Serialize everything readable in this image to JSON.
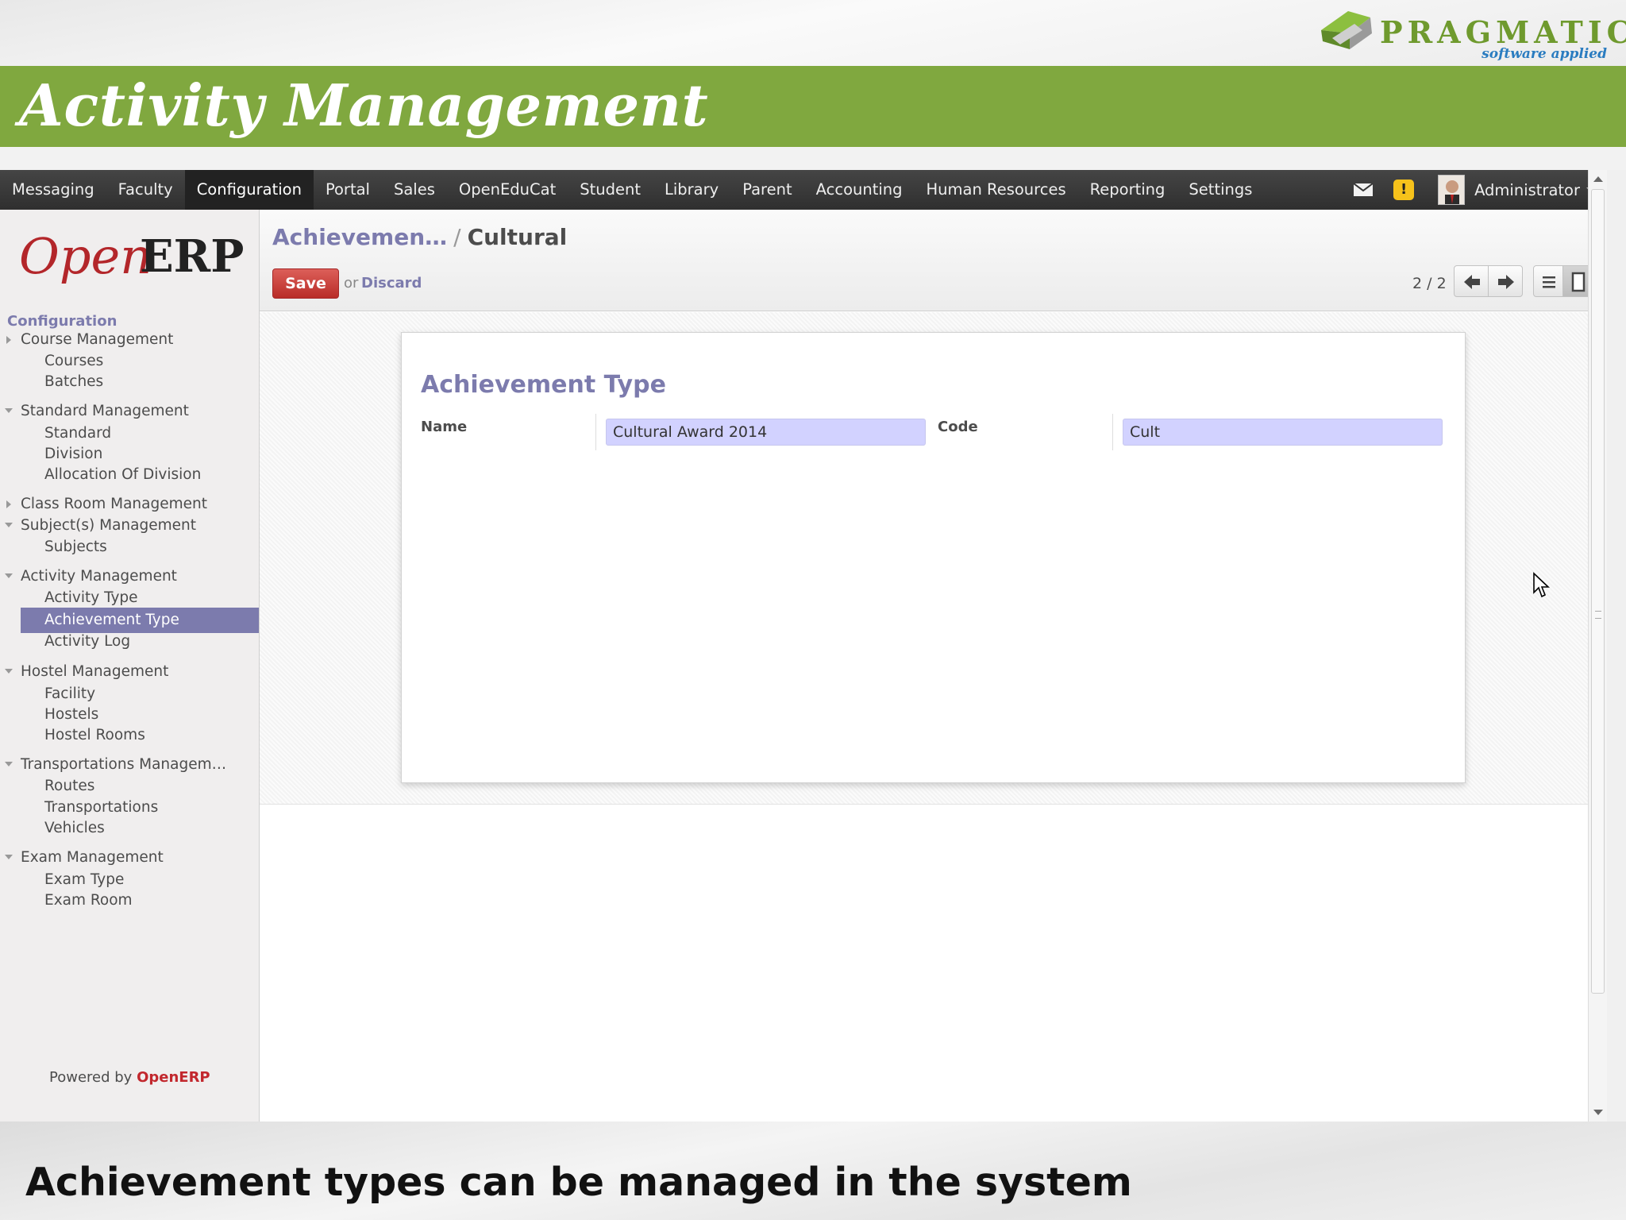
{
  "slide": {
    "brand_name": "PRAGMATIC",
    "brand_tagline": "software applied",
    "title": "Activity Management",
    "caption": "Achievement types can be managed  in the system"
  },
  "topbar": {
    "menu": [
      "Messaging",
      "Faculty",
      "Configuration",
      "Portal",
      "Sales",
      "OpenEduCat",
      "Student",
      "Library",
      "Parent",
      "Accounting",
      "Human Resources",
      "Reporting",
      "Settings"
    ],
    "active_menu": "Configuration",
    "user": "Administrator",
    "alert_glyph": "!"
  },
  "sidebar": {
    "logo_open": "Open",
    "logo_erp": "ERP",
    "section": "Configuration",
    "items": [
      {
        "label": "Course Management",
        "level": 0,
        "state": "closed"
      },
      {
        "label": "Courses",
        "level": 1
      },
      {
        "label": "Batches",
        "level": 1
      },
      {
        "label": "Standard Management",
        "level": 0,
        "state": "open"
      },
      {
        "label": "Standard",
        "level": 1
      },
      {
        "label": "Division",
        "level": 1
      },
      {
        "label": "Allocation Of Division",
        "level": 1
      },
      {
        "label": "Class Room Management",
        "level": 0,
        "state": "closed"
      },
      {
        "label": "Subject(s) Management",
        "level": 0,
        "state": "open"
      },
      {
        "label": "Subjects",
        "level": 1
      },
      {
        "label": "Activity Management",
        "level": 0,
        "state": "open"
      },
      {
        "label": "Activity Type",
        "level": 1
      },
      {
        "label": "Achievement Type",
        "level": 1,
        "selected": true
      },
      {
        "label": "Activity Log",
        "level": 1
      },
      {
        "label": "Hostel Management",
        "level": 0,
        "state": "open"
      },
      {
        "label": "Facility",
        "level": 1
      },
      {
        "label": "Hostels",
        "level": 1
      },
      {
        "label": "Hostel Rooms",
        "level": 1
      },
      {
        "label": "Transportations Managem…",
        "level": 0,
        "state": "open"
      },
      {
        "label": "Routes",
        "level": 1
      },
      {
        "label": "Transportations",
        "level": 1
      },
      {
        "label": "Vehicles",
        "level": 1
      },
      {
        "label": "Exam Management",
        "level": 0,
        "state": "open"
      },
      {
        "label": "Exam Type",
        "level": 1
      },
      {
        "label": "Exam Room",
        "level": 1
      }
    ],
    "powered_prefix": "Powered by ",
    "powered_brand": "OpenERP"
  },
  "content": {
    "breadcrumb_parent": "Achievemen…",
    "breadcrumb_sep": "/",
    "breadcrumb_current": "Cultural",
    "save_label": "Save",
    "or_label": "or",
    "discard_label": "Discard",
    "pager": "2 / 2"
  },
  "form": {
    "title": "Achievement Type",
    "name_label": "Name",
    "name_value": "Cultural Award 2014",
    "code_label": "Code",
    "code_value": "Cult"
  },
  "colors": {
    "banner_green": "#80a83f",
    "accent_purple": "#7c7bad",
    "save_red": "#c0392b",
    "input_bg": "#d2d2ff"
  }
}
